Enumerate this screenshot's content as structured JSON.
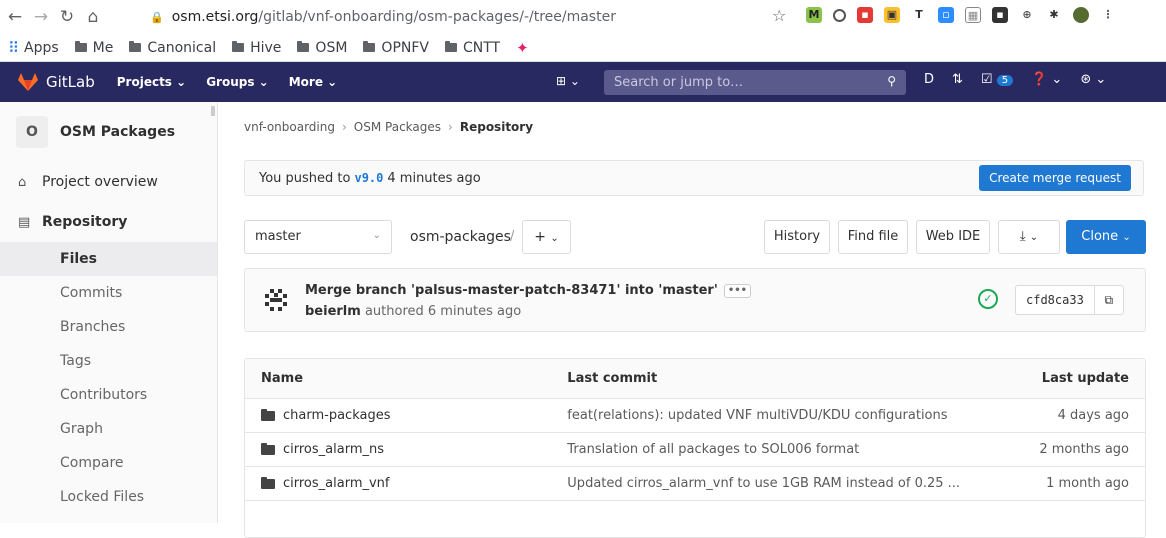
{
  "browser": {
    "url_host": "osm.etsi.org",
    "url_path": "/gitlab/vnf-onboarding/osm-packages/-/tree/master",
    "bookmarks": [
      "Apps",
      "Me",
      "Canonical",
      "Hive",
      "OSM",
      "OPNFV",
      "CNTT"
    ]
  },
  "gitlab_nav": {
    "brand": "GitLab",
    "projects": "Projects",
    "groups": "Groups",
    "more": "More",
    "search_placeholder": "Search or jump to…",
    "mr_count": "5"
  },
  "sidebar": {
    "project_initial": "O",
    "project_name": "OSM Packages",
    "overview": "Project overview",
    "repository": "Repository",
    "sub_items": [
      "Files",
      "Commits",
      "Branches",
      "Tags",
      "Contributors",
      "Graph",
      "Compare",
      "Locked Files"
    ],
    "active_sub": "Files"
  },
  "breadcrumb": [
    "vnf-onboarding",
    "OSM Packages",
    "Repository"
  ],
  "push_alert": {
    "prefix": "You pushed to",
    "branch": "v9.0",
    "suffix": "4 minutes ago",
    "button": "Create merge request"
  },
  "tree": {
    "branch": "master",
    "path": "osm-packages",
    "plus": "+",
    "history": "History",
    "find_file": "Find file",
    "web_ide": "Web IDE",
    "download": "⤓",
    "clone": "Clone"
  },
  "commit": {
    "title": "Merge branch 'palsus-master-patch-83471' into 'master'",
    "author": "beierlm",
    "authored": "authored 6 minutes ago",
    "sha": "cfd8ca33"
  },
  "files": {
    "headers": [
      "Name",
      "Last commit",
      "Last update"
    ],
    "rows": [
      {
        "name": "charm-packages",
        "commit": "feat(relations): updated VNF multiVDU/KDU configurations",
        "updated": "4 days ago"
      },
      {
        "name": "cirros_alarm_ns",
        "commit": "Translation of all packages to SOL006 format",
        "updated": "2 months ago"
      },
      {
        "name": "cirros_alarm_vnf",
        "commit": "Updated cirros_alarm_vnf to use 1GB RAM instead of 0.25 ...",
        "updated": "1 month ago"
      }
    ]
  },
  "colors": {
    "navbar": "#292961",
    "primary": "#1f78d1",
    "success": "#1aaa55"
  }
}
